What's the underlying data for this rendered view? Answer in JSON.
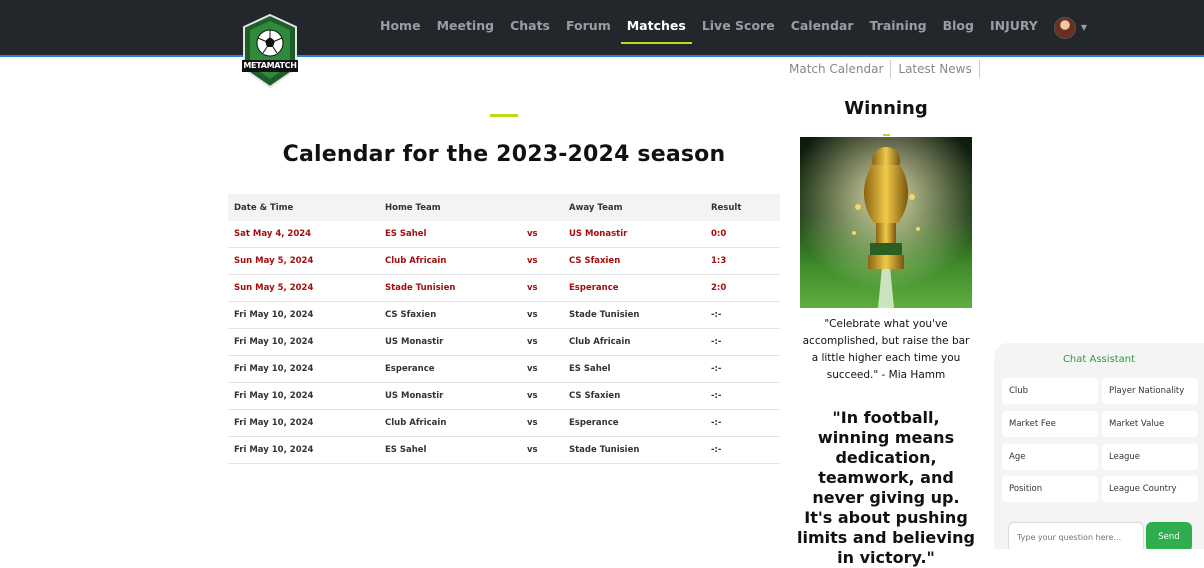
{
  "brand": {
    "name": "METAMATCH"
  },
  "nav": {
    "items": [
      {
        "label": "Home"
      },
      {
        "label": "Meeting"
      },
      {
        "label": "Chats"
      },
      {
        "label": "Forum"
      },
      {
        "label": "Matches",
        "active": true
      },
      {
        "label": "Live Score"
      },
      {
        "label": "Calendar"
      },
      {
        "label": "Training"
      },
      {
        "label": "Blog"
      },
      {
        "label": "INJURY"
      }
    ],
    "avatar_icon": "user-avatar",
    "caret_icon": "caret-down-icon"
  },
  "subnav": {
    "items": [
      "Match Calendar",
      "Latest News"
    ]
  },
  "main": {
    "title": "Calendar for the 2023-2024 season",
    "columns": [
      "Date & Time",
      "Home Team",
      "",
      "Away Team",
      "Result"
    ],
    "rows": [
      {
        "date": "Sat May 4, 2024",
        "home": "ES Sahel",
        "vs": "vs",
        "away": "US Monastir",
        "result": "0:0",
        "past": true
      },
      {
        "date": "Sun May 5, 2024",
        "home": "Club Africain",
        "vs": "vs",
        "away": "CS Sfaxien",
        "result": "1:3",
        "past": true
      },
      {
        "date": "Sun May 5, 2024",
        "home": "Stade Tunisien",
        "vs": "vs",
        "away": "Esperance",
        "result": "2:0",
        "past": true
      },
      {
        "date": "Fri May 10, 2024",
        "home": "CS Sfaxien",
        "vs": "vs",
        "away": "Stade Tunisien",
        "result": "-:-",
        "past": false
      },
      {
        "date": "Fri May 10, 2024",
        "home": "US Monastir",
        "vs": "vs",
        "away": "Club Africain",
        "result": "-:-",
        "past": false
      },
      {
        "date": "Fri May 10, 2024",
        "home": "Esperance",
        "vs": "vs",
        "away": "ES Sahel",
        "result": "-:-",
        "past": false
      },
      {
        "date": "Fri May 10, 2024",
        "home": "US Monastir",
        "vs": "vs",
        "away": "CS Sfaxien",
        "result": "-:-",
        "past": false
      },
      {
        "date": "Fri May 10, 2024",
        "home": "Club Africain",
        "vs": "vs",
        "away": "Esperance",
        "result": "-:-",
        "past": false
      },
      {
        "date": "Fri May 10, 2024",
        "home": "ES Sahel",
        "vs": "vs",
        "away": "Stade Tunisien",
        "result": "-:-",
        "past": false
      }
    ]
  },
  "sidebar": {
    "title": "Winning",
    "image_icon": "world-cup-trophy-image",
    "quote1": "\"Celebrate what you've accomplished, but raise the bar a little higher each time you succeed.\" - Mia Hamm",
    "quote2": "\"In football, winning means dedication, teamwork, and never giving up. It's about pushing limits and believing in victory.\""
  },
  "chat": {
    "title": "Chat Assistant",
    "chips": [
      "Club",
      "Player Nationality",
      "Market Fee",
      "Market Value",
      "Age",
      "League",
      "Position",
      "League Country"
    ],
    "placeholder": "Type your question here...",
    "send_label": "Send"
  },
  "colors": {
    "navbar_bg": "#23262b",
    "accent_green": "#b6dd19",
    "past_result": "#a40d0d",
    "chat_green": "#2eae4c"
  }
}
